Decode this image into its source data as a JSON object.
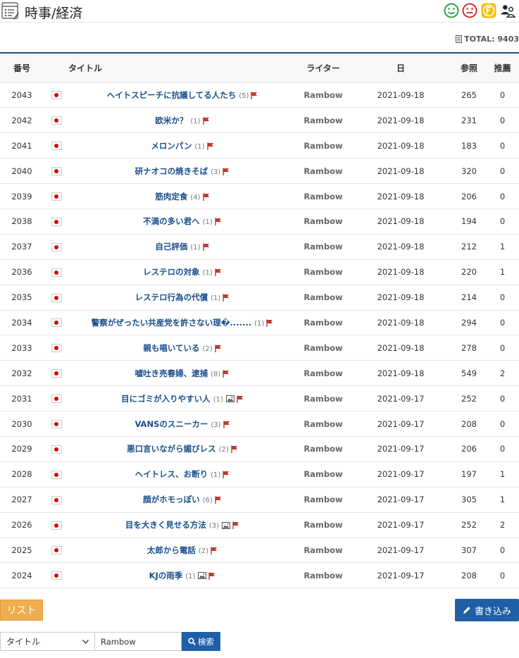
{
  "header": {
    "title": "時事/経済"
  },
  "total": {
    "label": "TOTAL: 9403"
  },
  "columns": {
    "num": "番号",
    "title": "タイトル",
    "writer": "ライター",
    "date": "日",
    "views": "参照",
    "votes": "推薦"
  },
  "posts": [
    {
      "num": "2043",
      "title": "ヘイトスピーチに抗議してる人たち",
      "comments": "(5)",
      "image": false,
      "writer": "Rambow",
      "date": "2021-09-18",
      "views": "265",
      "votes": "0"
    },
    {
      "num": "2042",
      "title": "欧米か？",
      "comments": "(1)",
      "image": false,
      "writer": "Rambow",
      "date": "2021-09-18",
      "views": "231",
      "votes": "0"
    },
    {
      "num": "2041",
      "title": "メロンパン",
      "comments": "(1)",
      "image": false,
      "writer": "Rambow",
      "date": "2021-09-18",
      "views": "183",
      "votes": "0"
    },
    {
      "num": "2040",
      "title": "研ナオコの焼きそば",
      "comments": "(3)",
      "image": false,
      "writer": "Rambow",
      "date": "2021-09-18",
      "views": "320",
      "votes": "0"
    },
    {
      "num": "2039",
      "title": "筋肉定食",
      "comments": "(4)",
      "image": false,
      "writer": "Rambow",
      "date": "2021-09-18",
      "views": "206",
      "votes": "0"
    },
    {
      "num": "2038",
      "title": "不満の多い君へ",
      "comments": "(1)",
      "image": false,
      "writer": "Rambow",
      "date": "2021-09-18",
      "views": "194",
      "votes": "0"
    },
    {
      "num": "2037",
      "title": "自己評価",
      "comments": "(1)",
      "image": false,
      "writer": "Rambow",
      "date": "2021-09-18",
      "views": "212",
      "votes": "1"
    },
    {
      "num": "2036",
      "title": "レステロの対象",
      "comments": "(1)",
      "image": false,
      "writer": "Rambow",
      "date": "2021-09-18",
      "views": "220",
      "votes": "1"
    },
    {
      "num": "2035",
      "title": "レステロ行為の代償",
      "comments": "(1)",
      "image": false,
      "writer": "Rambow",
      "date": "2021-09-18",
      "views": "214",
      "votes": "0"
    },
    {
      "num": "2034",
      "title": "警察がぜったい共産党を許さない理�.......",
      "comments": "(1)",
      "image": false,
      "writer": "Rambow",
      "date": "2021-09-18",
      "views": "294",
      "votes": "0"
    },
    {
      "num": "2033",
      "title": "親も唱いている",
      "comments": "(2)",
      "image": false,
      "writer": "Rambow",
      "date": "2021-09-18",
      "views": "278",
      "votes": "0"
    },
    {
      "num": "2032",
      "title": "嘘吐き売春婦、逮捕",
      "comments": "(8)",
      "image": false,
      "writer": "Rambow",
      "date": "2021-09-18",
      "views": "549",
      "votes": "2"
    },
    {
      "num": "2031",
      "title": "目にゴミが入りやすい人",
      "comments": "(1)",
      "image": true,
      "writer": "Rambow",
      "date": "2021-09-17",
      "views": "252",
      "votes": "0"
    },
    {
      "num": "2030",
      "title": "VANSのスニーカー",
      "comments": "(3)",
      "image": false,
      "writer": "Rambow",
      "date": "2021-09-17",
      "views": "208",
      "votes": "0"
    },
    {
      "num": "2029",
      "title": "悪口言いながら媚びレス",
      "comments": "(2)",
      "image": false,
      "writer": "Rambow",
      "date": "2021-09-17",
      "views": "206",
      "votes": "0"
    },
    {
      "num": "2028",
      "title": "ヘイトレス、お断り",
      "comments": "(1)",
      "image": false,
      "writer": "Rambow",
      "date": "2021-09-17",
      "views": "197",
      "votes": "1"
    },
    {
      "num": "2027",
      "title": "顔がホモっぽい",
      "comments": "(6)",
      "image": false,
      "writer": "Rambow",
      "date": "2021-09-17",
      "views": "305",
      "votes": "1"
    },
    {
      "num": "2026",
      "title": "目を大きく見せる方法",
      "comments": "(3)",
      "image": true,
      "writer": "Rambow",
      "date": "2021-09-17",
      "views": "252",
      "votes": "2"
    },
    {
      "num": "2025",
      "title": "太郎から電話",
      "comments": "(2)",
      "image": false,
      "writer": "Rambow",
      "date": "2021-09-17",
      "views": "307",
      "votes": "0"
    },
    {
      "num": "2024",
      "title": "KJの雨季",
      "comments": "(1)",
      "image": true,
      "writer": "Rambow",
      "date": "2021-09-17",
      "views": "208",
      "votes": "0"
    }
  ],
  "buttons": {
    "list": "リスト",
    "write": "書き込み"
  },
  "search": {
    "field": "タイトル",
    "value": "Rambow",
    "button": "検索"
  },
  "colors": {
    "accent": "#1f5fa8",
    "list_button": "#f0ad4e",
    "title_link": "#1a4f8b",
    "flag_red": "#c0392b"
  }
}
